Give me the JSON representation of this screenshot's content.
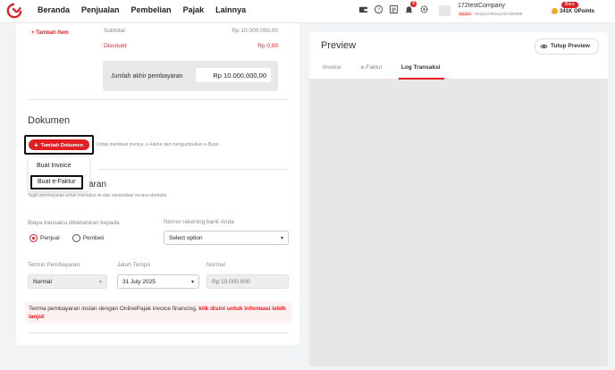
{
  "nav": {
    "items": [
      "Beranda",
      "Penjualan",
      "Pembelian",
      "Pajak",
      "Lainnya"
    ]
  },
  "header": {
    "notification_count": "5",
    "company_name": "172testCompany",
    "company_type": "Badan",
    "company_id": "091113799151310-000000",
    "new_badge": "Baru",
    "points": "341K OPoints"
  },
  "invoice": {
    "add_item": "Tambah Item",
    "subtotal_label": "Subtotal",
    "subtotal_value": "Rp 10.000.000,00",
    "discount_label": "Discount",
    "discount_value": "Rp 0,00",
    "total_label": "Jumlah akhir pembayaran",
    "total_value": "Rp 10.000.000,00"
  },
  "dokumen": {
    "title": "Dokumen",
    "add_button": "Tambah Dokumen",
    "hint": "Untuk membuat invoice, e-Faktur dan mengumpulkan e-Bupo",
    "menu": [
      "Buat Invoice",
      "Buat e-Faktur"
    ]
  },
  "payment": {
    "title_partial": "aran",
    "hint": "Tagih pembayaran untuk transaksi ini dan rekonsiliasi secara otomatis",
    "biaya_label": "Biaya transaksi dibebankan kepada",
    "radio_penjual": "Penjual",
    "radio_pembeli": "Pembeli",
    "rekening_label": "Nomor rekening bank Anda",
    "rekening_value": "Select option",
    "termin_label": "Termin Pembayaran",
    "termin_value": "Normal",
    "jatuh_tempo_label": "Jatuh Tempo",
    "jatuh_tempo_value": "31 July 2025",
    "normal_label": "Normal",
    "normal_value": "Rp 10.000.000",
    "info_text": "Terima pembayaran instan dengan OnlinePajak invoice financing, ",
    "info_link": "klik disini untuk informasi lebih lanjut"
  },
  "preview": {
    "title": "Preview",
    "close_button": "Tutup Preview",
    "tabs": [
      "Invoice",
      "e-Faktur",
      "Log Transaksi"
    ],
    "active_tab": "Log Transaksi"
  },
  "colors": {
    "accent": "#e31e24",
    "panel_bg": "#e7e7e7"
  }
}
